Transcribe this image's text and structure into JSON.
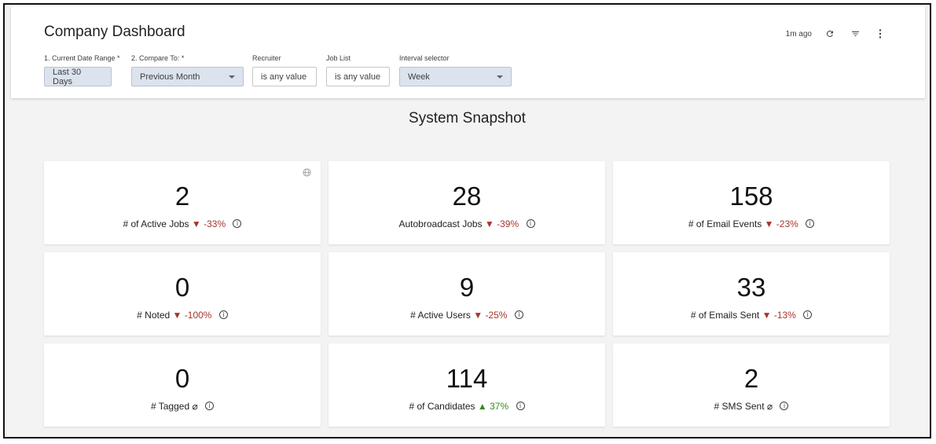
{
  "header": {
    "title": "Company Dashboard",
    "last_updated": "1m ago"
  },
  "filters": [
    {
      "label": "1. Current Date Range *",
      "value": "Last 30 Days"
    },
    {
      "label": "2. Compare To: *",
      "value": "Previous Month"
    },
    {
      "label": "Recruiter",
      "value": "is any value"
    },
    {
      "label": "Job List",
      "value": "is any value"
    },
    {
      "label": "Interval selector",
      "value": "Week"
    }
  ],
  "section": {
    "title": "System Snapshot"
  },
  "cards": [
    {
      "value": "2",
      "label": "# of Active Jobs",
      "arrow": "▼",
      "delta": "-33%"
    },
    {
      "value": "28",
      "label": "Autobroadcast Jobs",
      "arrow": "▼",
      "delta": "-39%"
    },
    {
      "value": "158",
      "label": "# of Email Events",
      "arrow": "▼",
      "delta": "-23%"
    },
    {
      "value": "0",
      "label": "# Noted",
      "arrow": "▼",
      "delta": "-100%"
    },
    {
      "value": "9",
      "label": "# Active Users",
      "arrow": "▼",
      "delta": "-25%"
    },
    {
      "value": "33",
      "label": "# of Emails Sent",
      "arrow": "▼",
      "delta": "-13%"
    },
    {
      "value": "0",
      "label": "# Tagged",
      "arrow": "",
      "delta": "⌀"
    },
    {
      "value": "114",
      "label": "# of Candidates",
      "arrow": "▲",
      "delta": "37%"
    },
    {
      "value": "2",
      "label": "# SMS Sent",
      "arrow": "",
      "delta": "⌀"
    }
  ],
  "icons": {
    "refresh": "refresh-icon",
    "filter": "filter-icon",
    "more": "more-vert-icon",
    "info": "info-icon",
    "globe": "globe-icon"
  },
  "colors": {
    "negative": "#a5362e",
    "positive": "#3b8a1f",
    "filled_filter": "#dde3ee"
  }
}
